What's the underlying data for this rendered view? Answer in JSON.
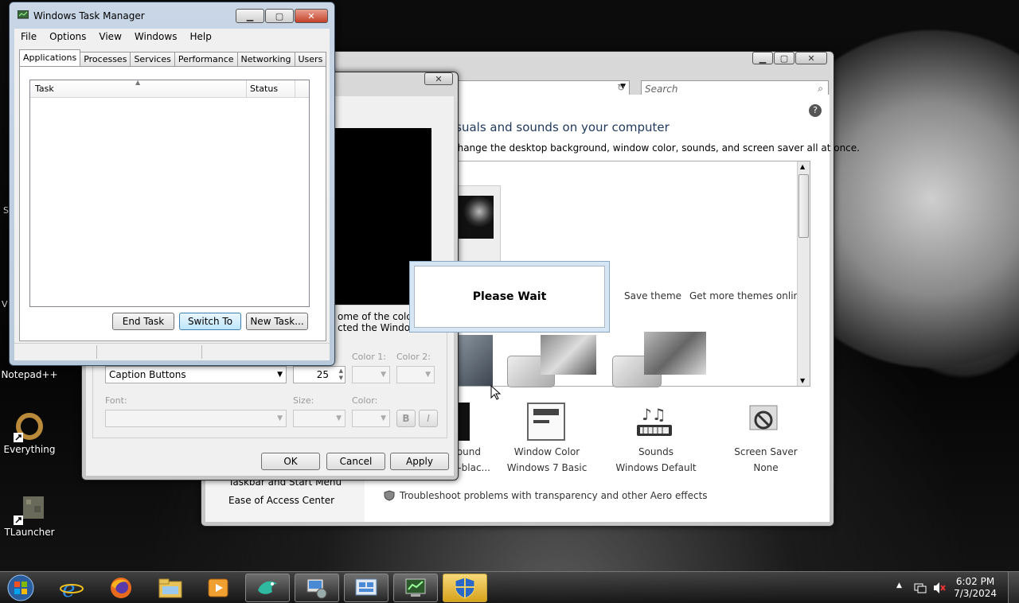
{
  "desktop": {
    "icons": [
      {
        "label": "Notepad++"
      },
      {
        "label": "Everything"
      },
      {
        "label": "TLauncher"
      }
    ]
  },
  "personalization": {
    "search_placeholder": "Search",
    "heading": "isuals and sounds on your computer",
    "subheading": "change the desktop background, window color, sounds, and screen saver all at once.",
    "links": {
      "save_theme": "Save theme",
      "get_more": "Get more themes online"
    },
    "bottom": [
      {
        "title": "round",
        "value": "e-blac..."
      },
      {
        "title": "Window Color",
        "value": "Windows 7 Basic"
      },
      {
        "title": "Sounds",
        "value": "Windows Default"
      },
      {
        "title": "Screen Saver",
        "value": "None"
      }
    ],
    "left_pane": {
      "taskbar": "Taskbar and Start Menu",
      "ease": "Ease of Access Center"
    },
    "troubleshoot": "Troubleshoot problems with transparency and other Aero effects"
  },
  "appearance": {
    "desc_line1": "ome of the color",
    "desc_line2": "cted the Window",
    "item_value": "Caption Buttons",
    "size_value": "25",
    "labels": {
      "color1": "Color 1:",
      "color2": "Color 2:",
      "font": "Font:",
      "size": "Size:",
      "color": "Color:"
    },
    "bold": "B",
    "italic": "I",
    "buttons": {
      "ok": "OK",
      "cancel": "Cancel",
      "apply": "Apply"
    }
  },
  "task_manager": {
    "title": "Windows Task Manager",
    "menu": [
      "File",
      "Options",
      "View",
      "Windows",
      "Help"
    ],
    "tabs": [
      "Applications",
      "Processes",
      "Services",
      "Performance",
      "Networking",
      "Users"
    ],
    "columns": {
      "task": "Task",
      "status": "Status"
    },
    "buttons": {
      "end_task": "End Task",
      "switch_to": "Switch To",
      "new_task": "New Task..."
    }
  },
  "please_wait": {
    "message": "Please Wait"
  },
  "taskbar": {
    "clock_time": "6:02 PM",
    "clock_date": "7/3/2024",
    "tray_arrow": "▲"
  },
  "colors": {
    "accent": "#3c7fb1",
    "title_text": "#1e395b"
  }
}
